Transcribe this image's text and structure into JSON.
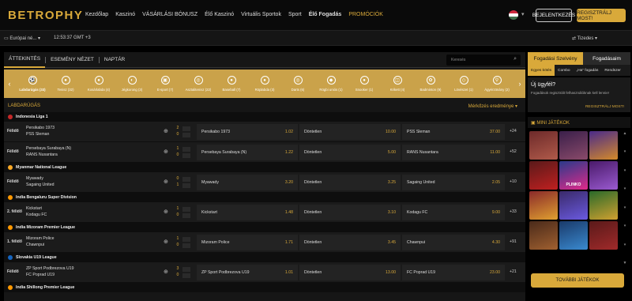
{
  "header": {
    "logo_a": "BET",
    "logo_b": "R",
    "logo_c": "OPHY",
    "nav": [
      "Kezdőlap",
      "Kaszinó",
      "VÁSÁRLÁSI BÓNUSZ",
      "Élő Kaszinó",
      "Virtuális Sportok",
      "Sport",
      "Élő Fogadás",
      "PROMÓCIÓK"
    ],
    "login": "BEJELENTKEZÉS",
    "register": "REGISZTRÁLJ MOST!"
  },
  "subbar": {
    "timezone": "Európai né...",
    "clock": "12:53:37 GMT +3",
    "odds_format": "Tizedes"
  },
  "tabs": [
    "ÁTTEKINTÉS",
    "ESEMÉNY NÉZET",
    "NAPTÁR"
  ],
  "search_placeholder": "Keresés",
  "sports": [
    {
      "label": "Labdarúgás (33)",
      "icon": "soccer-icon"
    },
    {
      "label": "Tenisz (32)",
      "icon": "tennis-icon"
    },
    {
      "label": "Kosárlabda (4)",
      "icon": "basketball-icon"
    },
    {
      "label": "Jégkorong (3)",
      "icon": "hockey-icon"
    },
    {
      "label": "E-sport (7)",
      "icon": "gamepad-icon"
    },
    {
      "label": "Asztalitenisz (22)",
      "icon": "table-tennis-icon"
    },
    {
      "label": "Baseball (7)",
      "icon": "baseball-icon"
    },
    {
      "label": "Röplabda (3)",
      "icon": "volleyball-icon"
    },
    {
      "label": "Darts (6)",
      "icon": "darts-icon"
    },
    {
      "label": "Rögbi uniós (1)",
      "icon": "rugby-icon"
    },
    {
      "label": "Snooker (1)",
      "icon": "snooker-icon"
    },
    {
      "label": "Krikett (4)",
      "icon": "cricket-icon"
    },
    {
      "label": "Badminton (9)",
      "icon": "badminton-icon"
    },
    {
      "label": "Lövészet (1)",
      "icon": "shooting-icon"
    },
    {
      "label": "Ágyérzönány (2)",
      "icon": "bandy-icon"
    }
  ],
  "section": {
    "title": "LABDARÚGÁS",
    "markets": "Mérkőzés eredménye"
  },
  "leagues": [
    {
      "name": "Indonesia Liga 1",
      "color": "#c62828",
      "matches": [
        {
          "when": "Félidő",
          "home": "Persikabo 1973",
          "away": "PSS Sleman",
          "hs": "2",
          "as": "0",
          "o1": "1.02",
          "ox": "10.00",
          "o2": "37.00",
          "more": "+24"
        },
        {
          "when": "Félidő",
          "home": "Persebaya Surabaya (N)",
          "away": "RANS Nusantara",
          "hs": "1",
          "as": "0",
          "o1": "1.22",
          "ox": "5.00",
          "o2": "11.00",
          "more": "+52"
        }
      ]
    },
    {
      "name": "Myanmar National League",
      "color": "#f9a825",
      "matches": [
        {
          "when": "Félidő",
          "home": "Myawady",
          "away": "Sagaing United",
          "hs": "0",
          "as": "1",
          "o1": "3.20",
          "ox": "3.25",
          "o2": "2.05",
          "more": "+10"
        }
      ]
    },
    {
      "name": "India Bengaluru Super Division",
      "color": "#ff9800",
      "matches": [
        {
          "when": "2. félidő",
          "home": "Kickstart",
          "away": "Kodagu FC",
          "hs": "1",
          "as": "0",
          "o1": "1.48",
          "ox": "3.10",
          "o2": "9.00",
          "more": "+33"
        }
      ]
    },
    {
      "name": "India Mizoram Premier League",
      "color": "#ff9800",
      "matches": [
        {
          "when": "1. félidő",
          "home": "Mizoram Police",
          "away": "Chawnpui",
          "hs": "1",
          "as": "0",
          "o1": "1.71",
          "ox": "3.45",
          "o2": "4.30",
          "more": "+91"
        }
      ]
    },
    {
      "name": "Slovakia U19 League",
      "color": "#1565c0",
      "matches": [
        {
          "when": "Félidő",
          "home": "ZP Sport Podbrezova U19",
          "away": "FC Poprad U19",
          "hs": "3",
          "as": "0",
          "o1": "1.01",
          "ox": "13.00",
          "o2": "23.00",
          "more": "+21"
        }
      ]
    },
    {
      "name": "India Shillong Premier League",
      "color": "#ff9800",
      "matches": []
    }
  ],
  "draw_label": "Döntetlen",
  "side": {
    "tab_slip": "Fogadási Szelvény",
    "tab_bets": "Fogadásaim",
    "sub": [
      "Egyes kötés",
      "Combo",
      "„Ha” fogadás",
      "Rendszer"
    ],
    "new_title": "Új ügyfél?",
    "new_desc": "Fogadások regisztrált felhasználóknak kell lennie!",
    "new_link": "REGISZTRÁLJ MOST!",
    "mini_title": "MINI JÁTÉKOK",
    "more_games": "TOVÁBBI JÁTÉKOK"
  },
  "games": [
    {
      "label": "",
      "c1": "#6d2a2a",
      "c2": "#b05a4a"
    },
    {
      "label": "",
      "c1": "#3a1f4a",
      "c2": "#8a4a6a"
    },
    {
      "label": "",
      "c1": "#4a2a8a",
      "c2": "#d48a2a"
    },
    {
      "label": "",
      "c1": "#5a1a1a",
      "c2": "#c02020"
    },
    {
      "label": "PLINKO",
      "c1": "#2a3a8a",
      "c2": "#e02a8a"
    },
    {
      "label": "",
      "c1": "#4a1a6a",
      "c2": "#9a5ad0"
    },
    {
      "label": "",
      "c1": "#8a2a2a",
      "c2": "#e0a030"
    },
    {
      "label": "",
      "c1": "#3a2a6a",
      "c2": "#6a5ae0"
    },
    {
      "label": "",
      "c1": "#2a6a2a",
      "c2": "#d0a030"
    },
    {
      "label": "",
      "c1": "#4a2a1a",
      "c2": "#a06030"
    },
    {
      "label": "",
      "c1": "#1a3a6a",
      "c2": "#3a8ad0"
    },
    {
      "label": "",
      "c1": "#5a1a1a",
      "c2": "#a02a2a"
    }
  ],
  "colors": {
    "accent": "#d9a93a",
    "sports_bar": "#caa24a"
  }
}
